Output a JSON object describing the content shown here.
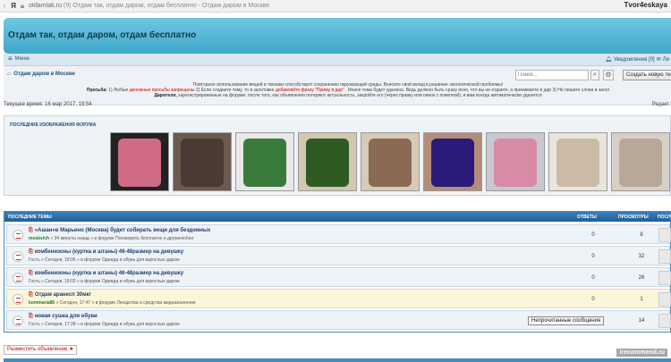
{
  "browser": {
    "nav_back": "‹",
    "logo": "Я",
    "url_domain": "otdamtak.ru",
    "url_title": "(9) Отдам так, отдам даром, отдам бесплатно - Отдам даром в Москве",
    "user": "Tvor4eskaya"
  },
  "header": {
    "title": "Отдам так, отдам даром, отдам бесплатно"
  },
  "navbar": {
    "menu_label": "Меню",
    "notifications_label": "Уведомления [9]",
    "extra_label": "Ли"
  },
  "breadcrumb": {
    "label": "Отдам даром в Москве"
  },
  "search": {
    "placeholder": "Поиск...",
    "button_icon": "search-icon"
  },
  "new_topic": {
    "label": "Создать новую тему"
  },
  "notice": {
    "line1": "Повторное использование вещей и техники способствует сохранению окружающей среды. Внесите свой вклад в решение экологической проблемы!",
    "please_label": "Просьба:",
    "line2a": "1) Любые",
    "line2_red": "денежные просьбы запрещены",
    "line2b": "2) Если создаете тему, то в заголовке",
    "line2_red2": "добавляйте фразу \"Приму в дар\"",
    "line2c": ". Иначе тема будет удалена. Ведь должно быть сразу ясно, что вы не отдаете, а принимаете в дар 3) Не пишите слова в загол",
    "thanks_label": "Дарители,",
    "line3": "зарегистрированные на форуме: после того, как объявления потеряют актуальность, закройте его (через правку или пинок с пометкой), и вам всегда автоматически удалится"
  },
  "time_line": "Текущее время: 16 мар 2017, 19:54",
  "edit_link": "Редакт",
  "images_block": {
    "label": "ПОСЛЕДНИЕ ИЗОБРАЖЕНИЯ ФОРУМА"
  },
  "thumbs": [
    {
      "name": "thumb-pink-jacket",
      "c1": "#d06b86",
      "c2": "#222222"
    },
    {
      "name": "thumb-dark-jacket",
      "c1": "#4a3a33",
      "c2": "#6d5a4e"
    },
    {
      "name": "thumb-shoe-dryer",
      "c1": "#3a7a3a",
      "c2": "#e8e8e8"
    },
    {
      "name": "thumb-plant",
      "c1": "#2f5a22",
      "c2": "#d2c8b0"
    },
    {
      "name": "thumb-round-item",
      "c1": "#8a6a52",
      "c2": "#d6cbb8"
    },
    {
      "name": "thumb-purple-shoes",
      "c1": "#2a1a7a",
      "c2": "#b38d7a"
    },
    {
      "name": "thumb-kid-coat",
      "c1": "#d98aa6",
      "c2": "#c8c8d0"
    },
    {
      "name": "thumb-highchair",
      "c1": "#cbbba6",
      "c2": "#e9e5dc"
    },
    {
      "name": "thumb-sweater",
      "c1": "#b8a89a",
      "c2": "#d8d0c6"
    }
  ],
  "topics": {
    "headers": {
      "topics": "ПОСЛЕДНИЕ ТЕМЫ",
      "answers": "ОТВЕТЫ",
      "views": "ПРОСМОТРЫ",
      "last": "ПОСЛ"
    },
    "rows": [
      {
        "title": "«Ашан»в Марьино (Москва) будет собирать вещи для бездомных",
        "author": "moskvich",
        "meta": " » 34 минуты назад » в форуме Поговорить бесплатно и дружелюбно",
        "answers": "0",
        "views": "8",
        "bg": "#eef3f8"
      },
      {
        "title": "комбенизоны (куртка и штаны) 46-48размер на девушку",
        "author": "Гость",
        "meta": " » Сегодня, 18:06 » в форуме Одежда и обувь для взрослых даром",
        "answers": "0",
        "views": "32",
        "bg": "#eef3f8"
      },
      {
        "title": "комбенизоны (куртка и штаны) 46-48размер на девушку",
        "author": "Гость",
        "meta": " » Сегодня, 18:03 » в форуме Одежда и обувь для взрослых даром",
        "answers": "0",
        "views": "26",
        "bg": "#eef3f8"
      },
      {
        "title": "Отдам аранесп 30мкг",
        "author": "kommaria86",
        "meta": " » Сегодня, 17:47 » в форуме Лекарства и средства медназначения",
        "answers": "0",
        "views": "1",
        "bg": "#fbf6d9"
      },
      {
        "title": "новая сушка для обуви",
        "author": "Гость",
        "meta": " » Сегодня, 17:28 » в форуме Одежда и обувь для взрослых даром",
        "answers": "0",
        "views": "14",
        "bg": "#eef3f8"
      }
    ],
    "unread_button": "Непрочитанные сообщения"
  },
  "post_ad": {
    "label": "Разместить объявление ★"
  },
  "watermark": "irecommend.ru"
}
